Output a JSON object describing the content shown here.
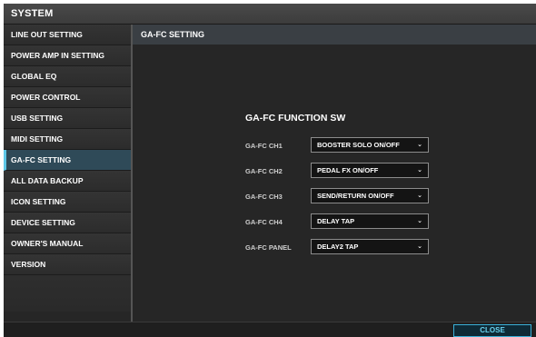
{
  "window": {
    "title": "SYSTEM"
  },
  "sidebar": {
    "items": [
      {
        "label": "LINE OUT SETTING",
        "active": false
      },
      {
        "label": "POWER AMP IN SETTING",
        "active": false
      },
      {
        "label": "GLOBAL EQ",
        "active": false
      },
      {
        "label": "POWER CONTROL",
        "active": false
      },
      {
        "label": "USB SETTING",
        "active": false
      },
      {
        "label": "MIDI SETTING",
        "active": false
      },
      {
        "label": "GA-FC SETTING",
        "active": true
      },
      {
        "label": "ALL DATA BACKUP",
        "active": false
      },
      {
        "label": "ICON SETTING",
        "active": false
      },
      {
        "label": "DEVICE SETTING",
        "active": false
      },
      {
        "label": "OWNER'S MANUAL",
        "active": false
      },
      {
        "label": "VERSION",
        "active": false
      }
    ]
  },
  "main": {
    "header": "GA-FC SETTING",
    "section_title": "GA-FC FUNCTION SW",
    "rows": [
      {
        "label": "GA-FC CH1",
        "value": "BOOSTER SOLO ON/OFF"
      },
      {
        "label": "GA-FC CH2",
        "value": "PEDAL FX ON/OFF"
      },
      {
        "label": "GA-FC CH3",
        "value": "SEND/RETURN ON/OFF"
      },
      {
        "label": "GA-FC CH4",
        "value": "DELAY TAP"
      },
      {
        "label": "GA-FC PANEL",
        "value": "DELAY2 TAP"
      }
    ]
  },
  "footer": {
    "close_label": "CLOSE"
  },
  "icons": {
    "dropdown": "chevron-down-icon"
  },
  "colors": {
    "accent": "#5ec8e8",
    "close_text": "#69d3f0"
  }
}
